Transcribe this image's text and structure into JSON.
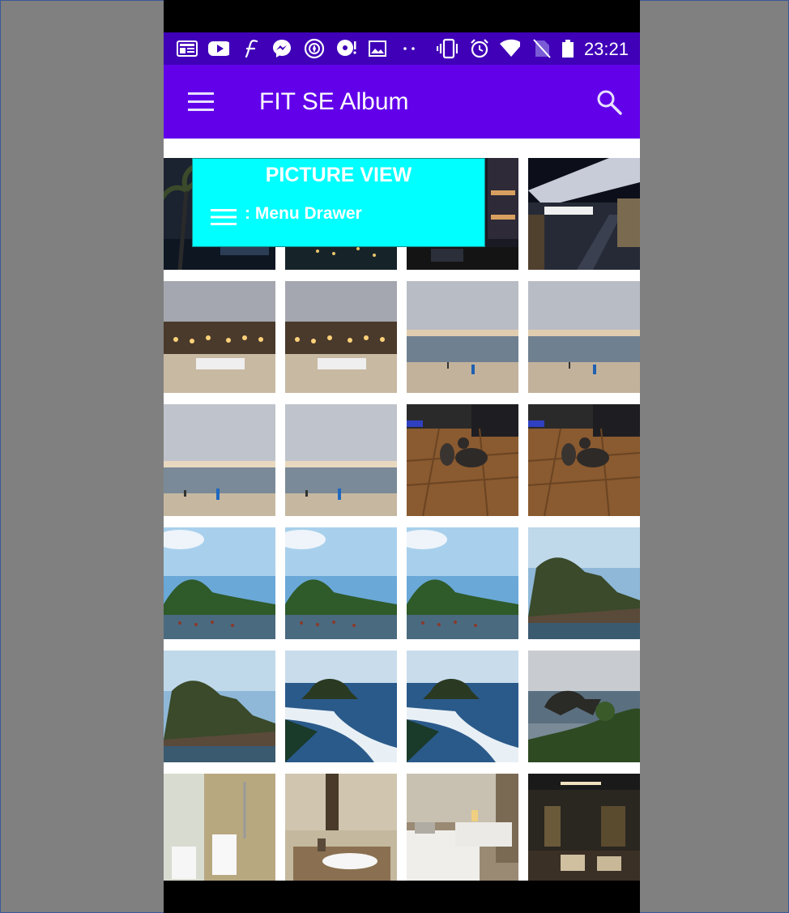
{
  "status_bar": {
    "time": "23:21",
    "icons": [
      "news-icon",
      "youtube-icon",
      "font-icon",
      "messenger-icon",
      "compass-icon",
      "music-icon",
      "image-icon",
      "more-dots-icon",
      "vibrate-icon",
      "alarm-icon",
      "wifi-icon",
      "no-sim-icon",
      "battery-icon"
    ]
  },
  "app_bar": {
    "title": "FIT SE Album",
    "background": "#6200ea"
  },
  "callout": {
    "title": "PICTURE VIEW",
    "text": ": Menu Drawer",
    "background": "#00ffff"
  },
  "grid": {
    "columns": 4,
    "photos": [
      {
        "scene": "night-palm"
      },
      {
        "scene": "night-city"
      },
      {
        "scene": "night-mall"
      },
      {
        "scene": "night-mall-escalator"
      },
      {
        "scene": "beach-dinner"
      },
      {
        "scene": "beach-dinner"
      },
      {
        "scene": "beach-sunset"
      },
      {
        "scene": "beach-sunset"
      },
      {
        "scene": "beach-cloudy"
      },
      {
        "scene": "beach-cloudy"
      },
      {
        "scene": "cats-floor"
      },
      {
        "scene": "cats-floor"
      },
      {
        "scene": "sea-coast-blue"
      },
      {
        "scene": "sea-coast-blue"
      },
      {
        "scene": "sea-coast-blue"
      },
      {
        "scene": "temple-rock"
      },
      {
        "scene": "temple-rock"
      },
      {
        "scene": "temple-waves"
      },
      {
        "scene": "temple-waves"
      },
      {
        "scene": "rock-arch"
      },
      {
        "scene": "bathroom"
      },
      {
        "scene": "bathroom-sink"
      },
      {
        "scene": "hotel-beds"
      },
      {
        "scene": "hotel-lounge"
      }
    ]
  }
}
